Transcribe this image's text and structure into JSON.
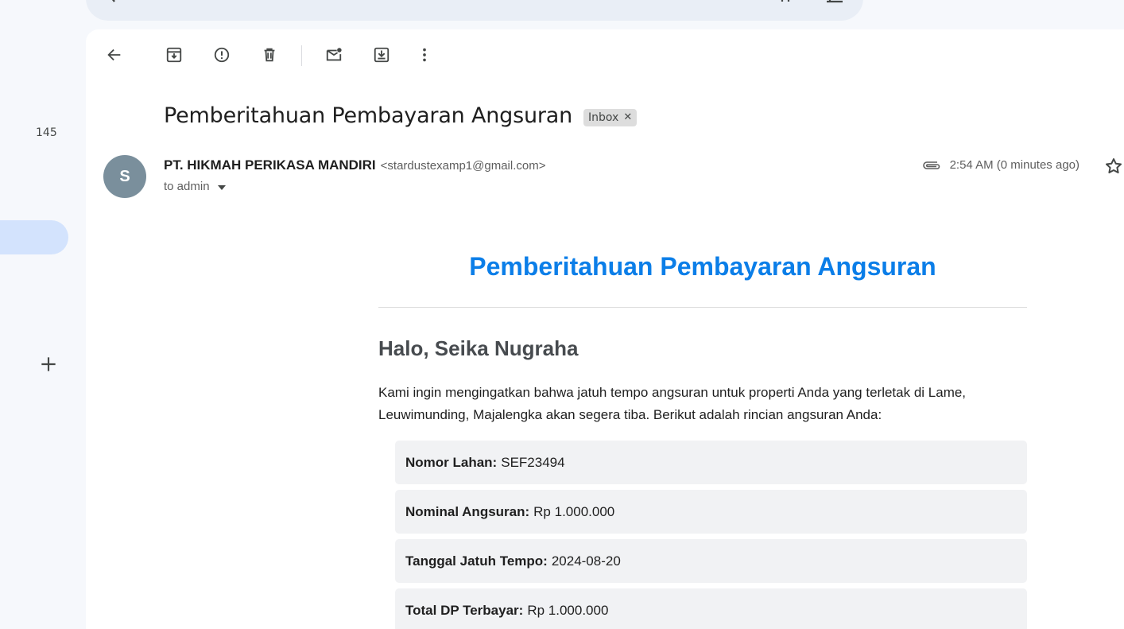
{
  "rail": {
    "count": "145"
  },
  "subject": "Pemberitahuan Pembayaran Angsuran",
  "label_chip": "Inbox",
  "sender": {
    "initial": "S",
    "name": "PT. HIKMAH PERIKASA MANDIRI",
    "email": "<stardustexamp1@gmail.com>",
    "to": "to admin"
  },
  "timestamp": "2:54 AM (0 minutes ago)",
  "email_body": {
    "title": "Pemberitahuan Pembayaran Angsuran",
    "greeting": "Halo, Seika Nugraha",
    "intro": "Kami ingin mengingatkan bahwa jatuh tempo angsuran untuk properti Anda yang terletak di Lame, Leuwimunding, Majalengka akan segera tiba. Berikut adalah rincian angsuran Anda:",
    "rows": [
      {
        "label": "Nomor Lahan:",
        "value": "SEF23494"
      },
      {
        "label": "Nominal Angsuran:",
        "value": "Rp 1.000.000"
      },
      {
        "label": "Tanggal Jatuh Tempo:",
        "value": "2024-08-20"
      },
      {
        "label": "Total DP Terbayar:",
        "value": "Rp 1.000.000"
      }
    ]
  },
  "icons": {
    "toolbar": [
      "back-arrow-icon",
      "archive-icon",
      "report-spam-icon",
      "delete-icon",
      "mark-unread-icon",
      "move-to-icon",
      "more-options-icon"
    ],
    "meta": [
      "attachment-icon",
      "star-icon"
    ]
  },
  "colors": {
    "accent": "#0b7ee8",
    "avatar": "#7a8f9c",
    "rail_active": "#d3e3fd"
  }
}
